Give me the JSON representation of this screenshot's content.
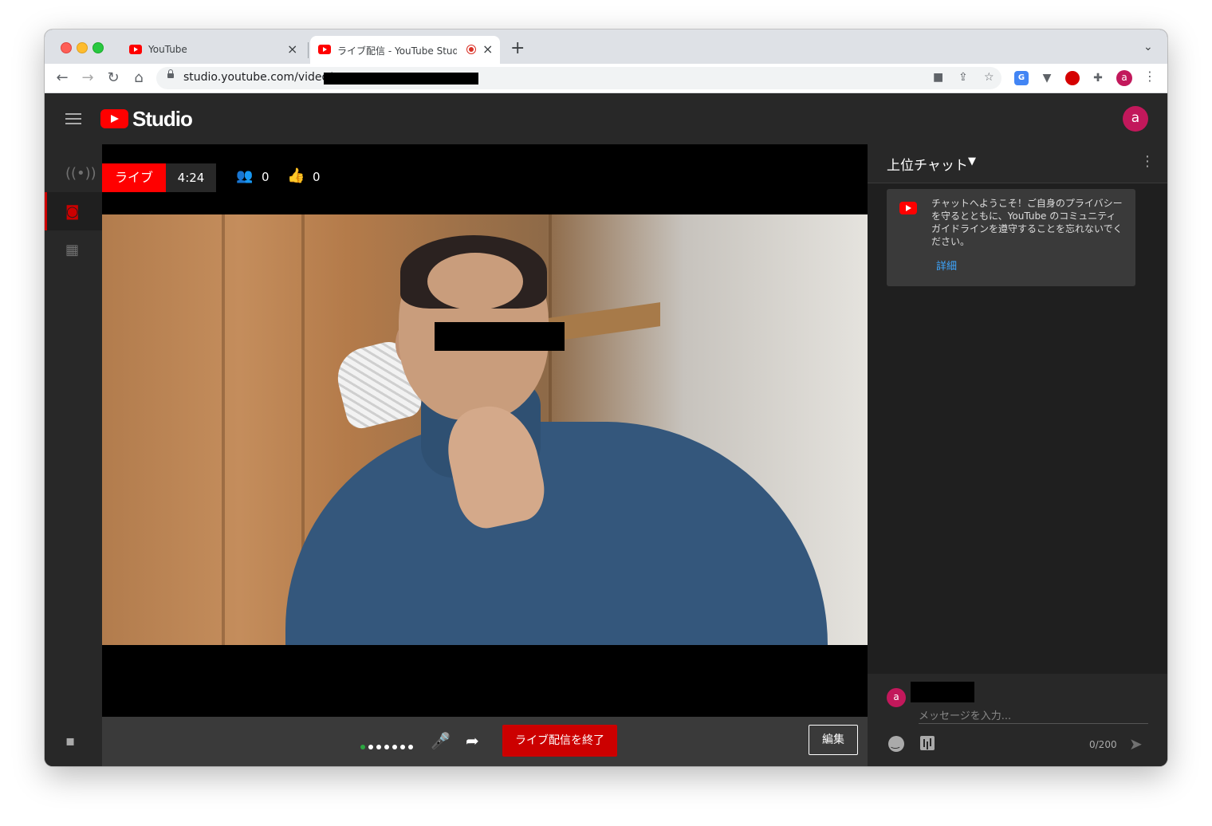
{
  "browser": {
    "tabs": [
      {
        "title": "YouTube",
        "close": "×"
      },
      {
        "title": "ライブ配信 - YouTube Studio",
        "close": "×"
      }
    ],
    "new_tab": "+",
    "tab_search": "⌄",
    "url": "studio.youtube.com/video/",
    "profile_initial": "a"
  },
  "studio": {
    "logo_text": "Studio",
    "avatar_initial": "a"
  },
  "stream": {
    "live_label": "ライブ",
    "elapsed": "4:24",
    "viewers": "0",
    "likes": "0"
  },
  "controls": {
    "end_stream_label": "ライブ配信を終了",
    "edit_label": "編集"
  },
  "chat": {
    "title": "上位チャット",
    "welcome_message": "チャットへようこそ！ご自身のプライバシーを守るとともに、YouTube のコミュニティ ガイドラインを遵守することを忘れないでください。",
    "learn_more": "詳細",
    "user_initial": "a",
    "input_placeholder": "メッセージを入力...",
    "char_count": "0/200"
  },
  "colors": {
    "youtube_red": "#ff0000",
    "end_button": "#cc0000",
    "avatar": "#c2185b",
    "link": "#3ea6ff",
    "mic_level_active": "#2ba640"
  },
  "icons": [
    "back-icon",
    "forward-icon",
    "reload-icon",
    "home-icon",
    "lock-icon",
    "camera-icon",
    "share-icon",
    "star-icon",
    "extensions-icon",
    "menu-icon",
    "live-icon",
    "webcam-icon",
    "calendar-icon",
    "feedback-icon",
    "viewers-icon",
    "thumbs-up-icon",
    "mic-icon",
    "share-arrow-icon",
    "emoji-icon",
    "poll-icon",
    "send-icon"
  ]
}
